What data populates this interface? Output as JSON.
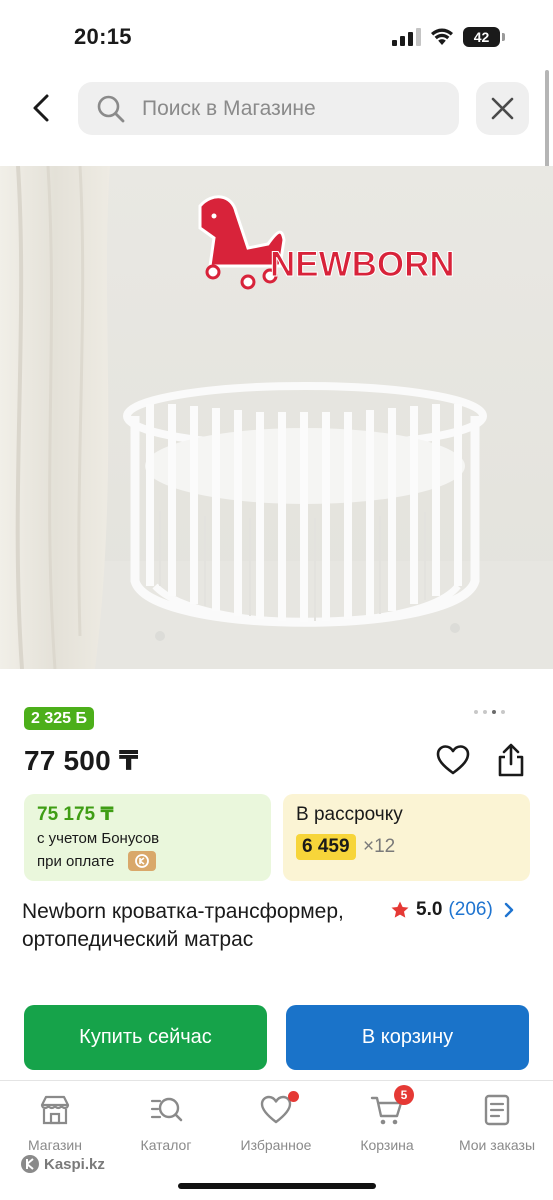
{
  "status_bar": {
    "time": "20:15",
    "battery_level": "42"
  },
  "search": {
    "placeholder": "Поиск в Магазине",
    "back_icon": "chevron-left-icon",
    "search_icon": "magnifier-icon",
    "close_icon": "close-icon"
  },
  "product": {
    "image_logo_text": "NEWBORN",
    "bonus_badge": "2 325 Б",
    "price": "77 500 ₸",
    "bonus_price": "75 175 ₸",
    "bonus_line1": "с учетом Бонусов",
    "bonus_line2": "при оплате",
    "installment_title": "В рассрочку",
    "installment_monthly": "6 459",
    "installment_months": "×12",
    "title": "Newborn кроватка-трансформер, ортопедический матрас",
    "rating_score": "5.0",
    "rating_count": "(206)"
  },
  "actions": {
    "buy_now": "Купить сейчас",
    "add_to_cart": "В корзину"
  },
  "bottom_nav": {
    "items": [
      {
        "label": "Магазин",
        "icon": "store-icon"
      },
      {
        "label": "Каталог",
        "icon": "catalog-search-icon"
      },
      {
        "label": "Избранное",
        "icon": "heart-icon"
      },
      {
        "label": "Корзина",
        "icon": "cart-icon",
        "badge": "5"
      },
      {
        "label": "Мои заказы",
        "icon": "orders-icon"
      }
    ]
  },
  "brand": {
    "text": "Kaspi.kz"
  },
  "colors": {
    "green_bonus": "#4caf1a",
    "buy_button": "#16a34a",
    "cart_button": "#1a73c9",
    "installment_highlight": "#f7d53a",
    "rating_star": "#e53935",
    "link_blue": "#1f74d0"
  }
}
